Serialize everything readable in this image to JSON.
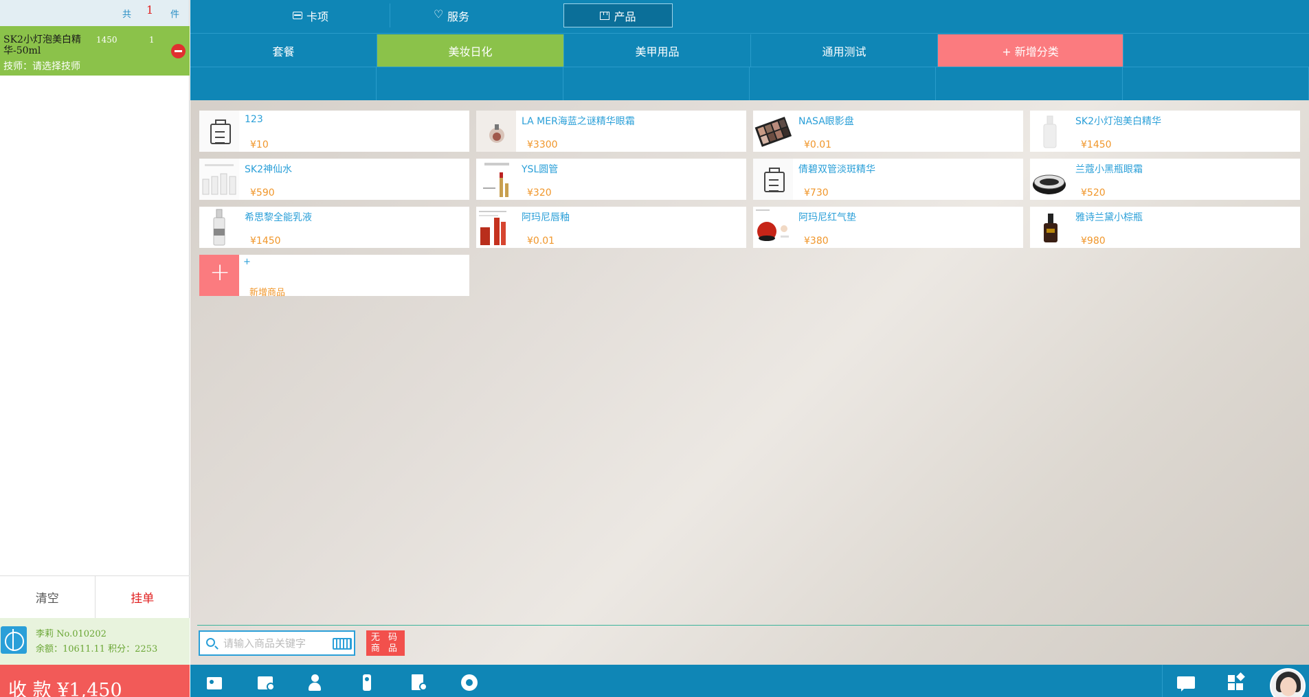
{
  "cart": {
    "header": {
      "total_label": "共",
      "count": "1",
      "unit_label": "件"
    },
    "items": [
      {
        "name": "SK2小灯泡美白精华-50ml",
        "price": "1450",
        "qty": "1",
        "technician": "技师：请选择技师"
      }
    ],
    "clear_label": "清空",
    "hold_label": "挂单"
  },
  "member": {
    "line1": "李莉 No.010202",
    "line2": "余额：10611.11 积分：2253"
  },
  "pay_label": "收 款 ¥1,450",
  "top_tabs": [
    {
      "label": "卡项",
      "icon": "card-icon"
    },
    {
      "label": "服务",
      "icon": "heart-icon"
    },
    {
      "label": "产品",
      "icon": "box-icon",
      "active": true
    }
  ],
  "categories": [
    {
      "label": "套餐"
    },
    {
      "label": "美妆日化",
      "active": true
    },
    {
      "label": "美甲用品"
    },
    {
      "label": "通用测试"
    },
    {
      "label": "+ 新增分类",
      "is_add": true
    }
  ],
  "products": [
    {
      "name": "123",
      "price": "¥10",
      "thumb": "placeholder-product-icon"
    },
    {
      "name": "LA MER海蓝之谜精华眼霜",
      "price": "¥3300",
      "thumb": "la-mer-eye-cream-photo"
    },
    {
      "name": "NASA眼影盘",
      "price": "¥0.01",
      "thumb": "eyeshadow-palette-photo"
    },
    {
      "name": "SK2小灯泡美白精华",
      "price": "¥1450",
      "thumb": "sk2-serum-photo"
    },
    {
      "name": "SK2神仙水",
      "price": "¥590",
      "thumb": "sk2-essence-photo"
    },
    {
      "name": "YSL圆管",
      "price": "¥320",
      "thumb": "ysl-lipstick-photo"
    },
    {
      "name": "倩碧双管淡斑精华",
      "price": "¥730",
      "thumb": "placeholder-product-icon"
    },
    {
      "name": "兰蔻小黑瓶眼霜",
      "price": "¥520",
      "thumb": "lancome-eye-cream-photo"
    },
    {
      "name": "希思黎全能乳液",
      "price": "¥1450",
      "thumb": "sisley-emulsion-photo"
    },
    {
      "name": "阿玛尼唇釉",
      "price": "¥0.01",
      "thumb": "armani-lip-gloss-photo"
    },
    {
      "name": "阿玛尼红气垫",
      "price": "¥380",
      "thumb": "armani-cushion-photo"
    },
    {
      "name": "雅诗兰黛小棕瓶",
      "price": "¥980",
      "thumb": "estee-lauder-serum-photo"
    }
  ],
  "add_product": {
    "plus": "+",
    "label": "新增商品"
  },
  "search": {
    "placeholder": "请输入商品关键字"
  },
  "no_code_label": "无 码 商 品",
  "colors": {
    "primary_blue": "#0f86b6",
    "active_green": "#8bc24a",
    "add_pink": "#fb7b7f",
    "pay_red": "#f25a58",
    "price_orange": "#f0962a",
    "name_blue": "#2a9fd8"
  },
  "bottom_icons": [
    "customer-card-icon",
    "appointment-calendar-icon",
    "add-member-icon",
    "locker-tag-icon",
    "order-history-icon",
    "settings-icon",
    "chat-icon",
    "apps-icon",
    "user-avatar"
  ]
}
